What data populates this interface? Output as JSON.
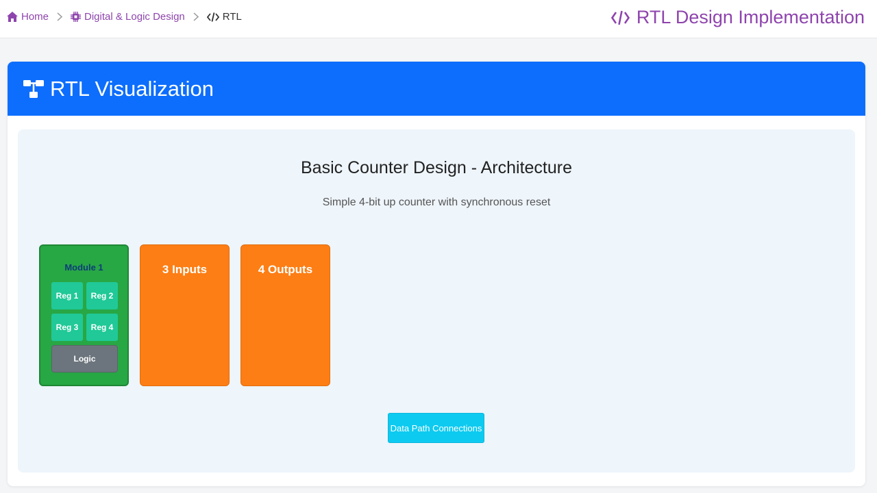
{
  "breadcrumb": {
    "home": "Home",
    "section": "Digital & Logic Design",
    "current": "RTL"
  },
  "app_title": "RTL Design Implementation",
  "card": {
    "header": "RTL Visualization"
  },
  "diagram": {
    "title": "Basic Counter Design - Architecture",
    "subtitle": "Simple 4-bit up counter with synchronous reset",
    "module_label": "Module 1",
    "registers": [
      "Reg 1",
      "Reg 2",
      "Reg 3",
      "Reg 4"
    ],
    "logic_label": "Logic",
    "inputs_label": "3 Inputs",
    "outputs_label": "4 Outputs",
    "button_label": "Data Path Connections"
  },
  "icons": {
    "home": "home-icon",
    "section": "chip-icon",
    "current": "code-icon",
    "title": "code-icon",
    "card": "sitemap-icon"
  },
  "colors": {
    "accent_purple": "#8e44ad",
    "header_blue": "#0d6efd",
    "module_green": "#28a745",
    "register_teal": "#20c997",
    "io_orange": "#fd7e14",
    "logic_gray": "#6c757d",
    "button_cyan": "#0dcaf0"
  }
}
